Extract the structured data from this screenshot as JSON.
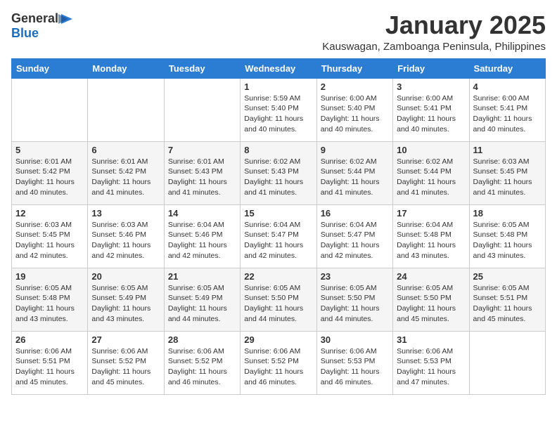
{
  "logo": {
    "general": "General",
    "blue": "Blue"
  },
  "title": "January 2025",
  "subtitle": "Kauswagan, Zamboanga Peninsula, Philippines",
  "days": [
    "Sunday",
    "Monday",
    "Tuesday",
    "Wednesday",
    "Thursday",
    "Friday",
    "Saturday"
  ],
  "weeks": [
    [
      {
        "num": "",
        "sunrise": "",
        "sunset": "",
        "daylight": ""
      },
      {
        "num": "",
        "sunrise": "",
        "sunset": "",
        "daylight": ""
      },
      {
        "num": "",
        "sunrise": "",
        "sunset": "",
        "daylight": ""
      },
      {
        "num": "1",
        "sunrise": "Sunrise: 5:59 AM",
        "sunset": "Sunset: 5:40 PM",
        "daylight": "Daylight: 11 hours and 40 minutes."
      },
      {
        "num": "2",
        "sunrise": "Sunrise: 6:00 AM",
        "sunset": "Sunset: 5:40 PM",
        "daylight": "Daylight: 11 hours and 40 minutes."
      },
      {
        "num": "3",
        "sunrise": "Sunrise: 6:00 AM",
        "sunset": "Sunset: 5:41 PM",
        "daylight": "Daylight: 11 hours and 40 minutes."
      },
      {
        "num": "4",
        "sunrise": "Sunrise: 6:00 AM",
        "sunset": "Sunset: 5:41 PM",
        "daylight": "Daylight: 11 hours and 40 minutes."
      }
    ],
    [
      {
        "num": "5",
        "sunrise": "Sunrise: 6:01 AM",
        "sunset": "Sunset: 5:42 PM",
        "daylight": "Daylight: 11 hours and 40 minutes."
      },
      {
        "num": "6",
        "sunrise": "Sunrise: 6:01 AM",
        "sunset": "Sunset: 5:42 PM",
        "daylight": "Daylight: 11 hours and 41 minutes."
      },
      {
        "num": "7",
        "sunrise": "Sunrise: 6:01 AM",
        "sunset": "Sunset: 5:43 PM",
        "daylight": "Daylight: 11 hours and 41 minutes."
      },
      {
        "num": "8",
        "sunrise": "Sunrise: 6:02 AM",
        "sunset": "Sunset: 5:43 PM",
        "daylight": "Daylight: 11 hours and 41 minutes."
      },
      {
        "num": "9",
        "sunrise": "Sunrise: 6:02 AM",
        "sunset": "Sunset: 5:44 PM",
        "daylight": "Daylight: 11 hours and 41 minutes."
      },
      {
        "num": "10",
        "sunrise": "Sunrise: 6:02 AM",
        "sunset": "Sunset: 5:44 PM",
        "daylight": "Daylight: 11 hours and 41 minutes."
      },
      {
        "num": "11",
        "sunrise": "Sunrise: 6:03 AM",
        "sunset": "Sunset: 5:45 PM",
        "daylight": "Daylight: 11 hours and 41 minutes."
      }
    ],
    [
      {
        "num": "12",
        "sunrise": "Sunrise: 6:03 AM",
        "sunset": "Sunset: 5:45 PM",
        "daylight": "Daylight: 11 hours and 42 minutes."
      },
      {
        "num": "13",
        "sunrise": "Sunrise: 6:03 AM",
        "sunset": "Sunset: 5:46 PM",
        "daylight": "Daylight: 11 hours and 42 minutes."
      },
      {
        "num": "14",
        "sunrise": "Sunrise: 6:04 AM",
        "sunset": "Sunset: 5:46 PM",
        "daylight": "Daylight: 11 hours and 42 minutes."
      },
      {
        "num": "15",
        "sunrise": "Sunrise: 6:04 AM",
        "sunset": "Sunset: 5:47 PM",
        "daylight": "Daylight: 11 hours and 42 minutes."
      },
      {
        "num": "16",
        "sunrise": "Sunrise: 6:04 AM",
        "sunset": "Sunset: 5:47 PM",
        "daylight": "Daylight: 11 hours and 42 minutes."
      },
      {
        "num": "17",
        "sunrise": "Sunrise: 6:04 AM",
        "sunset": "Sunset: 5:48 PM",
        "daylight": "Daylight: 11 hours and 43 minutes."
      },
      {
        "num": "18",
        "sunrise": "Sunrise: 6:05 AM",
        "sunset": "Sunset: 5:48 PM",
        "daylight": "Daylight: 11 hours and 43 minutes."
      }
    ],
    [
      {
        "num": "19",
        "sunrise": "Sunrise: 6:05 AM",
        "sunset": "Sunset: 5:48 PM",
        "daylight": "Daylight: 11 hours and 43 minutes."
      },
      {
        "num": "20",
        "sunrise": "Sunrise: 6:05 AM",
        "sunset": "Sunset: 5:49 PM",
        "daylight": "Daylight: 11 hours and 43 minutes."
      },
      {
        "num": "21",
        "sunrise": "Sunrise: 6:05 AM",
        "sunset": "Sunset: 5:49 PM",
        "daylight": "Daylight: 11 hours and 44 minutes."
      },
      {
        "num": "22",
        "sunrise": "Sunrise: 6:05 AM",
        "sunset": "Sunset: 5:50 PM",
        "daylight": "Daylight: 11 hours and 44 minutes."
      },
      {
        "num": "23",
        "sunrise": "Sunrise: 6:05 AM",
        "sunset": "Sunset: 5:50 PM",
        "daylight": "Daylight: 11 hours and 44 minutes."
      },
      {
        "num": "24",
        "sunrise": "Sunrise: 6:05 AM",
        "sunset": "Sunset: 5:50 PM",
        "daylight": "Daylight: 11 hours and 45 minutes."
      },
      {
        "num": "25",
        "sunrise": "Sunrise: 6:05 AM",
        "sunset": "Sunset: 5:51 PM",
        "daylight": "Daylight: 11 hours and 45 minutes."
      }
    ],
    [
      {
        "num": "26",
        "sunrise": "Sunrise: 6:06 AM",
        "sunset": "Sunset: 5:51 PM",
        "daylight": "Daylight: 11 hours and 45 minutes."
      },
      {
        "num": "27",
        "sunrise": "Sunrise: 6:06 AM",
        "sunset": "Sunset: 5:52 PM",
        "daylight": "Daylight: 11 hours and 45 minutes."
      },
      {
        "num": "28",
        "sunrise": "Sunrise: 6:06 AM",
        "sunset": "Sunset: 5:52 PM",
        "daylight": "Daylight: 11 hours and 46 minutes."
      },
      {
        "num": "29",
        "sunrise": "Sunrise: 6:06 AM",
        "sunset": "Sunset: 5:52 PM",
        "daylight": "Daylight: 11 hours and 46 minutes."
      },
      {
        "num": "30",
        "sunrise": "Sunrise: 6:06 AM",
        "sunset": "Sunset: 5:53 PM",
        "daylight": "Daylight: 11 hours and 46 minutes."
      },
      {
        "num": "31",
        "sunrise": "Sunrise: 6:06 AM",
        "sunset": "Sunset: 5:53 PM",
        "daylight": "Daylight: 11 hours and 47 minutes."
      },
      {
        "num": "",
        "sunrise": "",
        "sunset": "",
        "daylight": ""
      }
    ]
  ]
}
